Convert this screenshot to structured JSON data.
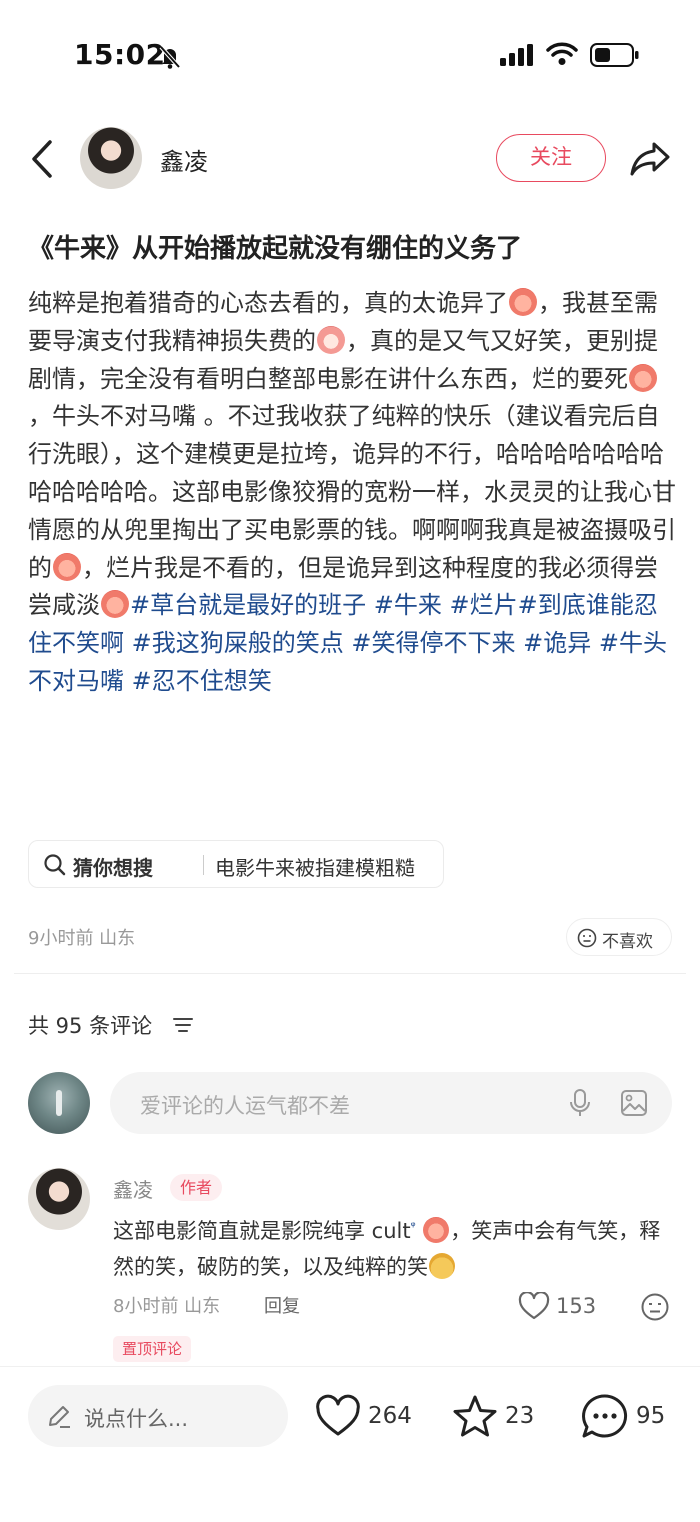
{
  "status_bar": {
    "time": "15:02"
  },
  "header": {
    "author_name": "鑫凌",
    "follow_label": "关注"
  },
  "post": {
    "title": "《牛来》从开始播放起就没有绷住的义务了",
    "body_segments": {
      "s1": "纯粹是抱着猎奇的心态去看的，真的太诡异了",
      "s2": "，我甚至需要导演支付我精神损失费的",
      "s3": "，真的是又气又好笑，更别提剧情，完全没有看明白整部电影在讲什么东西，烂的要死",
      "s4": "，牛头不对马嘴 。不过我收获了纯粹的快乐（建议看完后自行洗眼），这个建模更是拉垮，诡异的不行，哈哈哈哈哈哈哈哈哈哈哈哈。这部电影像狡猾的宽粉一样，水灵灵的让我心甘情愿的从兜里掏出了买电影票的钱。啊啊啊我真是被盗摄吸引的",
      "s5": "，烂片我是不看的，但是诡异到这种程度的我必须得尝尝咸淡"
    },
    "tags": [
      "#草台就是最好的班子",
      "#牛来",
      "#烂片",
      "#到底谁能忍住不笑啊",
      "#我这狗屎般的笑点",
      "#笑得停不下来",
      "#诡异",
      "#牛头不对马嘴",
      "#忍不住想笑"
    ],
    "suggest": {
      "label": "猜你想搜",
      "query": "电影牛来被指建模粗糙"
    },
    "time_location": "9小时前 山东",
    "dislike_label": "不喜欢"
  },
  "comments_section": {
    "count_label": "共 95 条评论",
    "input_placeholder": "爱评论的人运气都不差",
    "comment": {
      "name": "鑫凌",
      "badge": "作者",
      "text_1": "这部电影简直就是影院纯享 cult",
      "text_2": "，笑声中会有气笑，释然的笑，破防的笑，以及纯粹的笑",
      "time_location": "8小时前 山东",
      "reply_label": "回复",
      "likes": "153",
      "pinned_label": "置顶评论"
    }
  },
  "bottom_bar": {
    "input_placeholder": "说点什么...",
    "likes": "264",
    "stars": "23",
    "comments": "95"
  },
  "colors": {
    "accent": "#e84a5f",
    "tag": "#1f4b8e"
  }
}
